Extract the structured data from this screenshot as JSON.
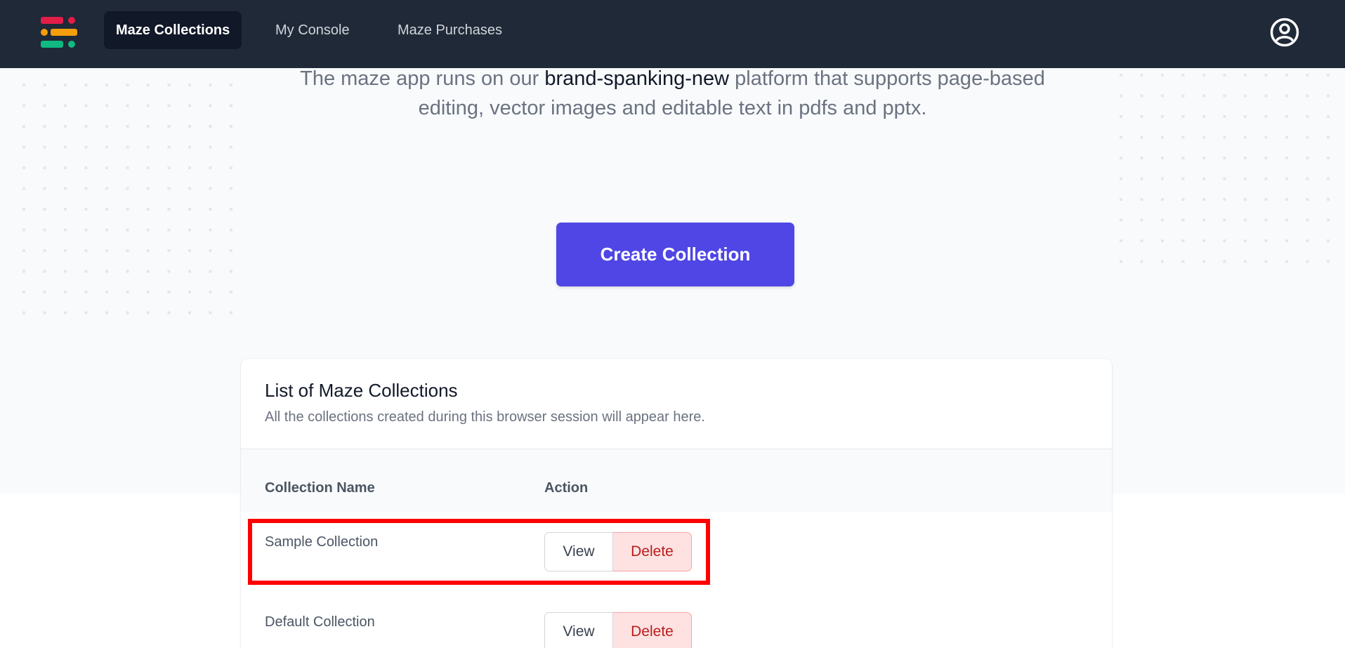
{
  "nav": {
    "items": [
      {
        "label": "Maze Collections",
        "active": true
      },
      {
        "label": "My Console",
        "active": false
      },
      {
        "label": "Maze Purchases",
        "active": false
      }
    ],
    "logo_icon": "logo-icon",
    "profile_icon": "user-circle-icon"
  },
  "hero": {
    "text_before": "The maze app runs on our ",
    "text_highlight": "brand-spanking-new",
    "text_after": " platform that supports page-based editing, vector images and editable text in pdfs and pptx.",
    "create_button": "Create Collection"
  },
  "collections": {
    "title": "List of Maze Collections",
    "subtitle": "All the collections created during this browser session will appear here.",
    "columns": [
      "Collection Name",
      "Action"
    ],
    "rows": [
      {
        "name": "Sample Collection",
        "view": "View",
        "delete": "Delete"
      },
      {
        "name": "Default Collection",
        "view": "View",
        "delete": "Delete"
      }
    ]
  },
  "colors": {
    "navbar": "#1f2937",
    "accent": "#4f46e5",
    "delete_bg": "#fee2e2",
    "delete_text": "#b91c1c",
    "highlight": "#ff0000"
  }
}
